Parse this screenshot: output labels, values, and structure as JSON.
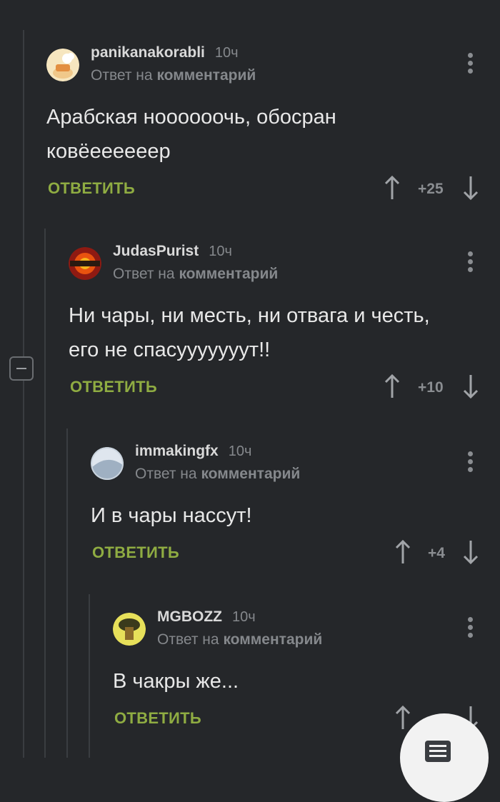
{
  "reply_label": "ОТВЕТИТЬ",
  "reply_prefix": "Ответ на",
  "reply_link": "комментарий",
  "comments": [
    {
      "username": "panikanakorabli",
      "time": "10ч",
      "text_lines": [
        "Арабская ноооооочь, обосран",
        "ковёеееееер"
      ],
      "score": "+25"
    },
    {
      "username": "JudasPurist",
      "time": "10ч",
      "text_lines": [
        "Ни чары, ни месть, ни отвага и честь,",
        "его не спасууууууут!!"
      ],
      "score": "+10"
    },
    {
      "username": "immakingfx",
      "time": "10ч",
      "text_lines": [
        "И в чары нассут!"
      ],
      "score": "+4"
    },
    {
      "username": "MGBOZZ",
      "time": "10ч",
      "text_lines": [
        "В чакры же..."
      ],
      "score": ""
    }
  ],
  "colors": {
    "background": "#25272a",
    "accent_green": "#8fac42",
    "muted": "#85888c"
  },
  "icons": {
    "upvote": "arrow-up-icon",
    "downvote": "arrow-down-icon",
    "menu": "more-vertical-icon",
    "collapse": "minus-square-icon",
    "fab": "list-icon"
  }
}
